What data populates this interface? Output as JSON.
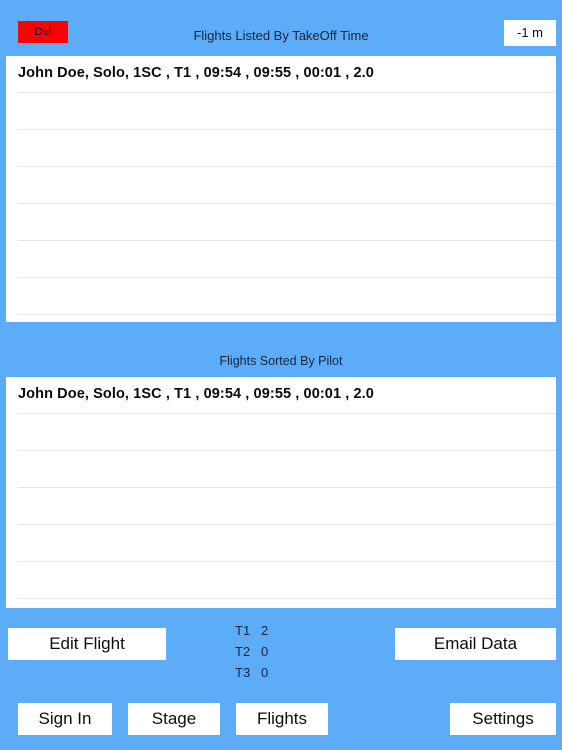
{
  "topbar": {
    "delete_label": "Del",
    "title": "Flights Listed By TakeOff Time",
    "time_adjust_label": "-1 m"
  },
  "takeoff_list": {
    "rows": [
      {
        "text": "John Doe,  Solo,  1SC , T1 , 09:54 , 09:55 , 00:01 , 2.0"
      },
      {
        "text": ""
      },
      {
        "text": ""
      },
      {
        "text": ""
      },
      {
        "text": ""
      },
      {
        "text": ""
      },
      {
        "text": ""
      }
    ]
  },
  "pilot_section": {
    "title": "Flights Sorted By Pilot"
  },
  "pilot_list": {
    "rows": [
      {
        "text": "John Doe,  Solo,  1SC , T1 , 09:54 , 09:55 , 00:01 , 2.0"
      },
      {
        "text": ""
      },
      {
        "text": ""
      },
      {
        "text": ""
      },
      {
        "text": ""
      },
      {
        "text": ""
      }
    ]
  },
  "controls": {
    "edit_flight_label": "Edit Flight",
    "email_data_label": "Email Data",
    "tow_counts": [
      {
        "key": "T1",
        "value": "2"
      },
      {
        "key": "T2",
        "value": "0"
      },
      {
        "key": "T3",
        "value": "0"
      }
    ]
  },
  "toolbar": {
    "sign_in_label": "Sign In",
    "stage_label": "Stage",
    "flights_label": "Flights",
    "settings_label": "Settings"
  },
  "colors": {
    "background_blue": "#5cacf7",
    "panel_white": "#ffffff",
    "delete_red": "#fe0000",
    "text_navy": "#16243d",
    "separator_gray": "#e6e6e6"
  }
}
